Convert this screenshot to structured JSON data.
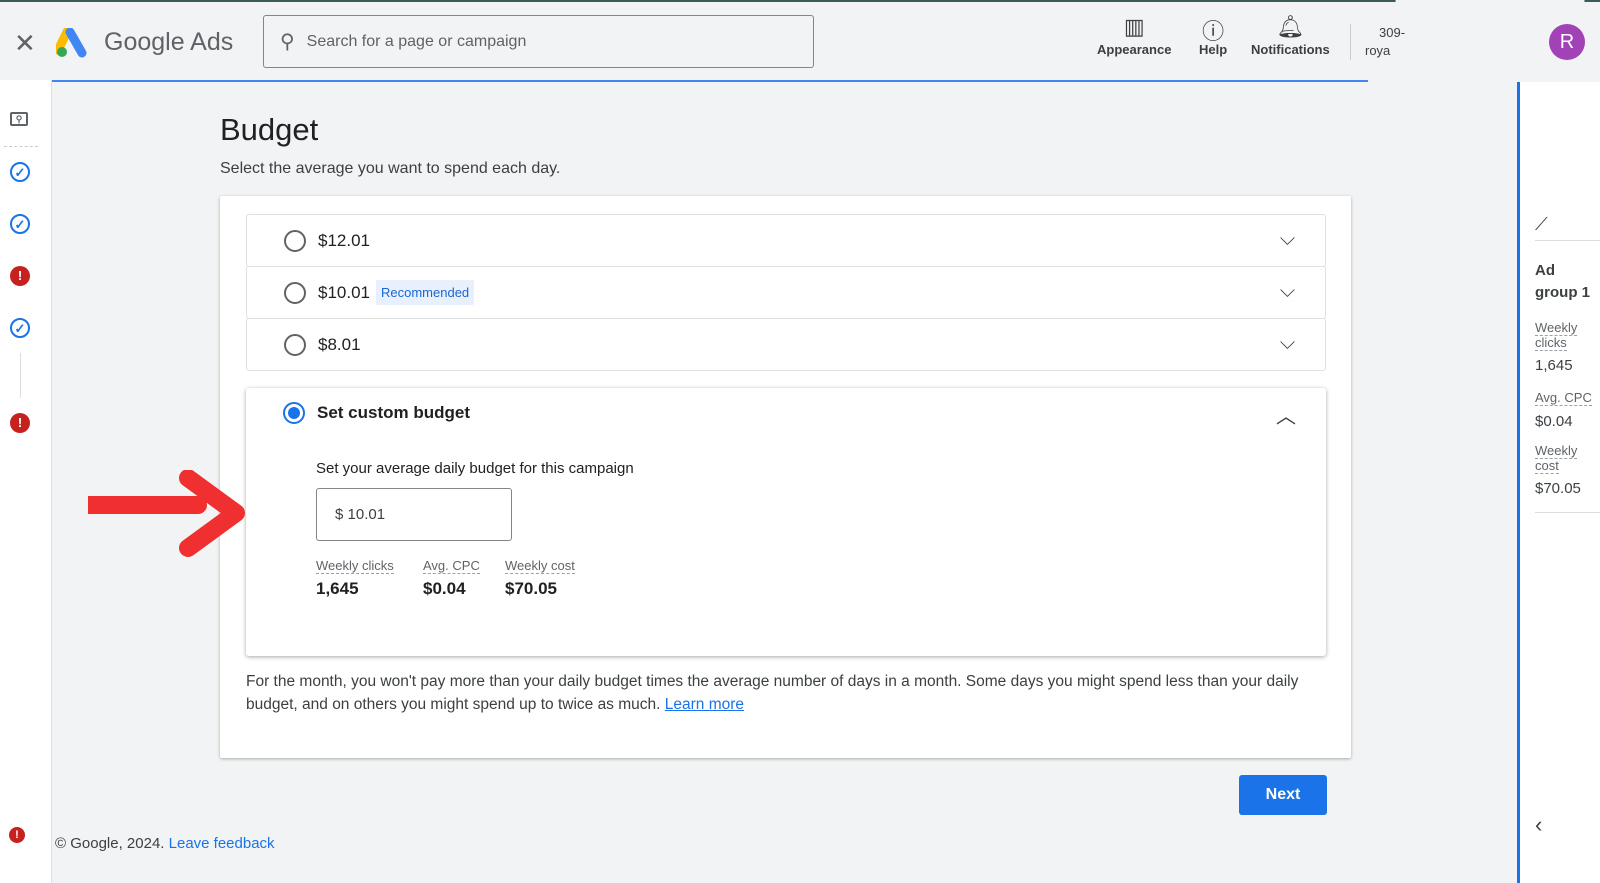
{
  "header": {
    "brand": "Google Ads",
    "search_placeholder": "Search for a page or campaign",
    "appearance": "Appearance",
    "help": "Help",
    "notifications": "Notifications",
    "account_line1": "309-",
    "account_line2": "roya",
    "avatar_initial": "R"
  },
  "page": {
    "title": "Budget",
    "subtitle": "Select the average you want to spend each day."
  },
  "options": [
    {
      "label": "$12.01"
    },
    {
      "label": "$10.01",
      "badge": "Recommended"
    },
    {
      "label": "$8.01"
    }
  ],
  "custom": {
    "label": "Set custom budget",
    "selected": true,
    "prompt": "Set your average daily budget for this campaign",
    "value": "$ 10.01",
    "stats": [
      {
        "label": "Weekly clicks",
        "value": "1,645"
      },
      {
        "label": "Avg. CPC",
        "value": "$0.04"
      },
      {
        "label": "Weekly cost",
        "value": "$70.05"
      }
    ]
  },
  "note": "For the month, you won't pay more than your daily budget times the average number of days in a month. Some days you might spend less than your daily budget, and on others you might spend up to twice as much.",
  "learn_more": "Learn more",
  "next": "Next",
  "footer": {
    "copyright": "© Google, 2024.",
    "feedback": "Leave feedback"
  },
  "right_panel": {
    "title": "Ad group 1",
    "stats": [
      {
        "label": "Weekly clicks",
        "value": "1,645"
      },
      {
        "label": "Avg. CPC",
        "value": "$0.04"
      },
      {
        "label": "Weekly cost",
        "value": "$70.05"
      }
    ]
  },
  "colors": {
    "accent": "#1a73e8",
    "error": "#c5221f",
    "arrow": "#f03030",
    "avatar": "#a142b7"
  }
}
